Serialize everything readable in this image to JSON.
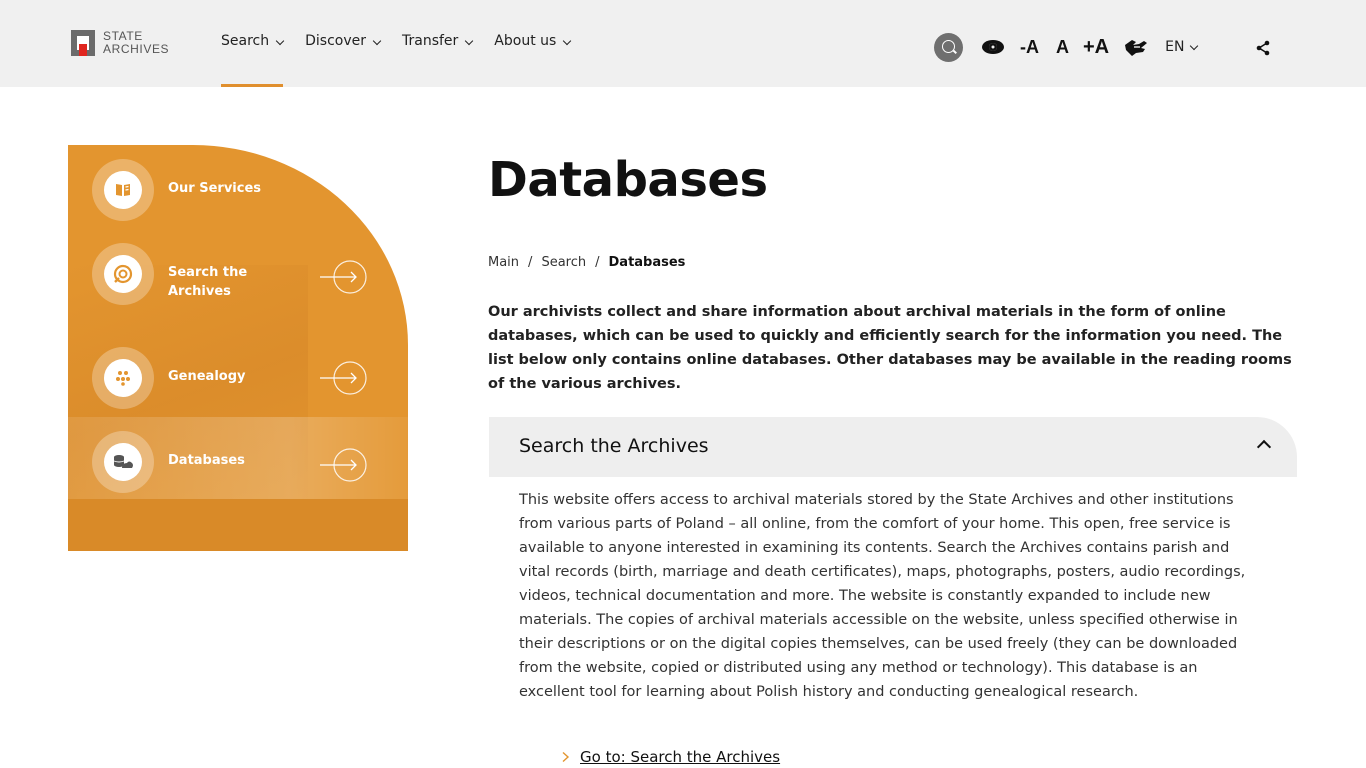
{
  "header": {
    "logo": {
      "line1": "STATE",
      "line2": "ARCHIVES"
    },
    "nav": [
      {
        "label": "Search"
      },
      {
        "label": "Discover"
      },
      {
        "label": "Transfer"
      },
      {
        "label": "About us"
      }
    ],
    "tools": {
      "font_decrease": "-A",
      "font_normal": "A",
      "font_increase": "+A",
      "language": "EN"
    }
  },
  "sidebar": {
    "items": [
      {
        "label": "Our Services",
        "icon": "book-icon"
      },
      {
        "label": "Search the Archives",
        "icon": "archive-search-icon"
      },
      {
        "label": "Genealogy",
        "icon": "family-tree-icon"
      },
      {
        "label": "Databases",
        "icon": "database-icon"
      }
    ]
  },
  "main": {
    "title": "Databases",
    "breadcrumb": [
      {
        "label": "Main"
      },
      {
        "label": "Search"
      },
      {
        "label": "Databases"
      }
    ],
    "intro": "Our archivists collect and share information about archival materials in the form of online databases, which can be used to quickly and efficiently search for the information you need.  The list below only contains online databases. Other databases may be available in the reading rooms of the various archives.",
    "accordion": {
      "title": "Search the Archives",
      "body": "This website offers access to archival materials stored by the State Archives and other institutions from various parts of Poland – all online, from the comfort of your home. This open, free service is available to anyone interested in examining its contents. Search the Archives contains parish and vital records (birth, marriage and death certificates), maps, photographs, posters, audio recordings, videos, technical documentation and more. The website is constantly expanded to include new materials. The copies of archival materials accessible on the website, unless specified otherwise in their descriptions or on the digital copies themselves, can be used freely (they can be downloaded from the website, copied or distributed using any method or technology). This database is an excellent tool for learning about Polish history and conducting genealogical research.",
      "link_label": "Go to: Search the Archives"
    }
  },
  "colors": {
    "accent": "#e3952f",
    "header_bg": "#f0f0f0",
    "logo_red": "#e0261f"
  }
}
